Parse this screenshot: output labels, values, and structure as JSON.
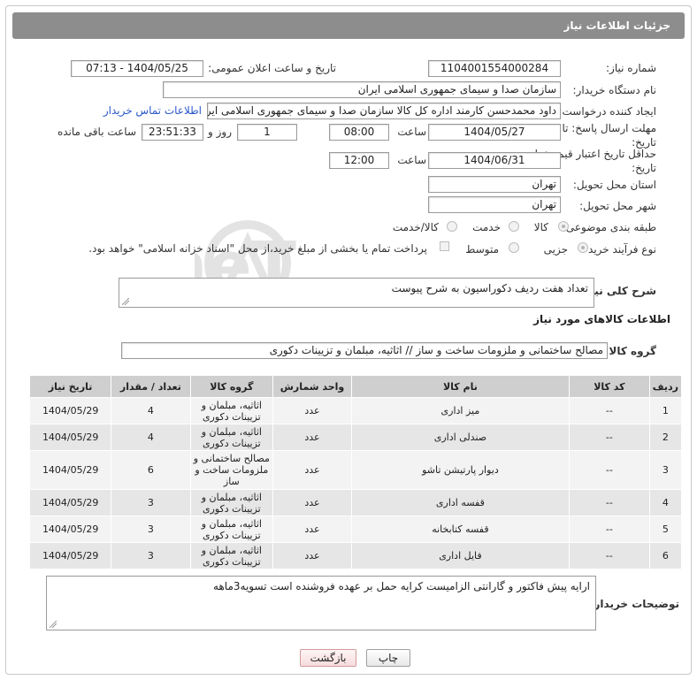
{
  "header": {
    "title": "جزئیات اطلاعات نیاز"
  },
  "form": {
    "need_number": {
      "label": "شماره نیاز:",
      "value": "1104001554000284"
    },
    "announce": {
      "label": "تاریخ و ساعت اعلان عمومی:",
      "value": "1404/05/25 - 07:13"
    },
    "buyer_org": {
      "label": "نام دستگاه خریدار:",
      "value": "سازمان صدا و سیمای جمهوری اسلامی ایران"
    },
    "requester": {
      "label": "ایجاد کننده درخواست:",
      "value": "داود محمدحسن کارمند اداره کل کالا سازمان صدا و سیمای جمهوری اسلامی ایران",
      "contact_link": "اطلاعات تماس خریدار"
    },
    "reply_deadline": {
      "label": "مهلت ارسال پاسخ: تا تاریخ:",
      "date": "1404/05/27",
      "time_label": "ساعت",
      "time": "08:00",
      "days": "1",
      "days_label": "روز و",
      "remaining": "23:51:33",
      "remaining_label": "ساعت باقی مانده"
    },
    "price_validity": {
      "label": "حداقل تاریخ اعتبار قیمت: تا تاریخ:",
      "date": "1404/06/31",
      "time_label": "ساعت",
      "time": "12:00"
    },
    "province": {
      "label": "استان محل تحویل:",
      "value": "تهران"
    },
    "city": {
      "label": "شهر محل تحویل:",
      "value": "تهران"
    },
    "category": {
      "label": "طبقه بندی موضوعی:",
      "options": [
        "کالا",
        "خدمت",
        "کالا/خدمت"
      ],
      "selected": "کالا"
    },
    "process": {
      "label": "نوع فرآیند خرید :",
      "options": [
        "جزیی",
        "متوسط"
      ],
      "selected": "جزیی",
      "payment_note": "پرداخت تمام یا بخشی از مبلغ خرید،از محل \"اسناد خزانه اسلامی\" خواهد بود."
    },
    "summary": {
      "label": "شرح کلی نیاز:",
      "value": "تعداد هفت ردیف دکوراسیون به شرح پیوست"
    }
  },
  "goods_info": {
    "title": "اطلاعات کالاهای مورد نیاز",
    "group_label": "گروه کالا:",
    "group_value": "مصالح ساختمانی و ملزومات ساخت و ساز // اثاثیه، مبلمان و تزیینات دکوری"
  },
  "table": {
    "headers": [
      "ردیف",
      "کد کالا",
      "نام کالا",
      "واحد شمارش",
      "گروه کالا",
      "تعداد / مقدار",
      "تاریخ نیاز"
    ],
    "rows": [
      {
        "idx": "1",
        "code": "--",
        "name": "میز اداری",
        "unit": "عدد",
        "group": "اثاثیه، مبلمان و تزیینات دکوری",
        "qty": "4",
        "date": "1404/05/29"
      },
      {
        "idx": "2",
        "code": "--",
        "name": "صندلی اداری",
        "unit": "عدد",
        "group": "اثاثیه، مبلمان و تزیینات دکوری",
        "qty": "4",
        "date": "1404/05/29"
      },
      {
        "idx": "3",
        "code": "--",
        "name": "دیوار پارتیشن تاشو",
        "unit": "عدد",
        "group": "مصالح ساختمانی و ملزومات ساخت و ساز",
        "qty": "6",
        "date": "1404/05/29"
      },
      {
        "idx": "4",
        "code": "--",
        "name": "قفسه اداری",
        "unit": "عدد",
        "group": "اثاثیه، مبلمان و تزیینات دکوری",
        "qty": "3",
        "date": "1404/05/29"
      },
      {
        "idx": "5",
        "code": "--",
        "name": "قفسه کتابخانه",
        "unit": "عدد",
        "group": "اثاثیه، مبلمان و تزیینات دکوری",
        "qty": "3",
        "date": "1404/05/29"
      },
      {
        "idx": "6",
        "code": "--",
        "name": "فایل اداری",
        "unit": "عدد",
        "group": "اثاثیه، مبلمان و تزیینات دکوری",
        "qty": "3",
        "date": "1404/05/29"
      }
    ]
  },
  "buyer_notes": {
    "label": "توضیحات خریدار:",
    "value": "ارایه پیش فاکتور و گارانتی الزامیست کرایه حمل بر عهده فروشنده است  تسویه3ماهه"
  },
  "buttons": {
    "print": "چاپ",
    "back": "بازگشت"
  },
  "watermark": {
    "text": "AriaTender.neT"
  },
  "colors": {
    "header_bg": "#8d8d8d",
    "table_header_bg": "#cfcfcf",
    "link": "#2a57c8",
    "back_button_bg": "#f6dcdc"
  }
}
